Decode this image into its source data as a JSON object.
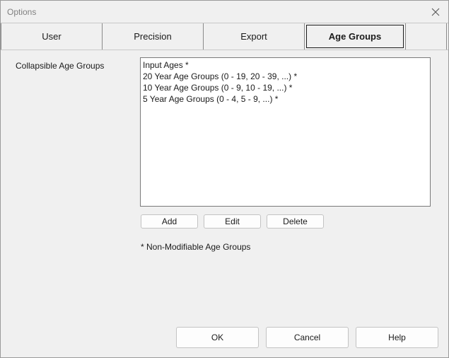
{
  "window": {
    "title": "Options"
  },
  "tabs": [
    {
      "label": "User",
      "active": false
    },
    {
      "label": "Precision",
      "active": false
    },
    {
      "label": "Export",
      "active": false
    },
    {
      "label": "Age Groups",
      "active": true
    }
  ],
  "age_groups": {
    "label": "Collapsible Age Groups",
    "items": [
      "Input Ages *",
      "20 Year Age Groups (0 - 19, 20 - 39, ...) *",
      "10 Year Age Groups (0 - 9, 10 - 19, ...) *",
      "5 Year Age Groups (0 - 4, 5 - 9, ...) *"
    ],
    "add_label": "Add",
    "edit_label": "Edit",
    "delete_label": "Delete",
    "note": "* Non-Modifiable Age Groups"
  },
  "footer": {
    "ok_label": "OK",
    "cancel_label": "Cancel",
    "help_label": "Help"
  },
  "icons": {
    "close": "close-icon"
  }
}
